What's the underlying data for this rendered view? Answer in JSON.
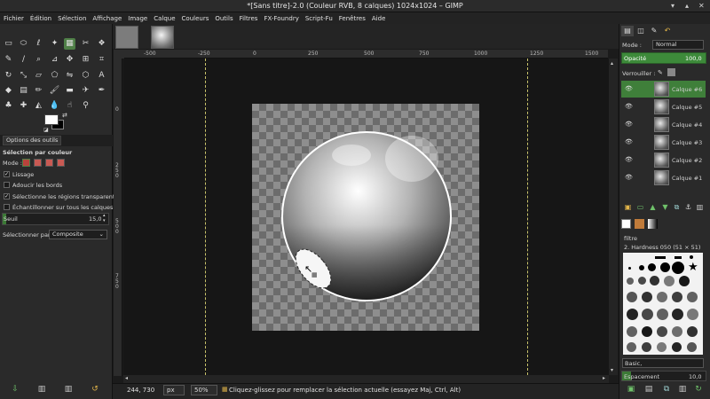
{
  "window": {
    "title": "*[Sans titre]-2.0 (Couleur RVB, 8 calques) 1024x1024 – GIMP"
  },
  "menu": [
    "Fichier",
    "Édition",
    "Sélection",
    "Affichage",
    "Image",
    "Calque",
    "Couleurs",
    "Outils",
    "Filtres",
    "FX-Foundry",
    "Script-Fu",
    "Fenêtres",
    "Aide"
  ],
  "tool_options": {
    "tab_label": "Options des outils",
    "title": "Sélection par couleur",
    "mode_label": "Mode :",
    "lissage": "Lissage",
    "adoucir": "Adoucir les bords",
    "transparent": "Sélectionne les régions transparentes",
    "sample_merged": "Échantillonner sur tous les calques",
    "seuil_label": "Seuil",
    "seuil_value": "15,0",
    "seuil_fraction": 0.04,
    "select_by_label": "Sélectionner par :",
    "select_by_value": "Composite"
  },
  "rulers": {
    "h": [
      "-500",
      "-250",
      "0",
      "250",
      "500",
      "750",
      "1000",
      "1250",
      "1500"
    ],
    "v": [
      "0",
      "2 5 0",
      "5 0 0",
      "7 5 0"
    ]
  },
  "status": {
    "coords": "244, 730",
    "unit": "px",
    "zoom": "50%",
    "message": "Cliquez-glissez pour remplacer la sélection actuelle (essayez Maj, Ctrl, Alt)"
  },
  "layers_panel": {
    "mode_label": "Mode :",
    "mode_value": "Normal",
    "opacity_label": "Opacité",
    "opacity_value": "100,0",
    "lock_label": "Verrouiller :",
    "layers": [
      "Calque #6",
      "Calque #5",
      "Calque #4",
      "Calque #3",
      "Calque #2",
      "Calque #1"
    ]
  },
  "brushes_panel": {
    "filter_label": "filtre",
    "brush_name": "2. Hardness 050 (51 × 51)",
    "preset": "Basic,",
    "spacing_label": "Espacement",
    "spacing_value": "10,0"
  },
  "colors": {
    "accent": "#4f7f47",
    "selected_layer": "#3f7f3a",
    "guide": "#c8c26a"
  }
}
